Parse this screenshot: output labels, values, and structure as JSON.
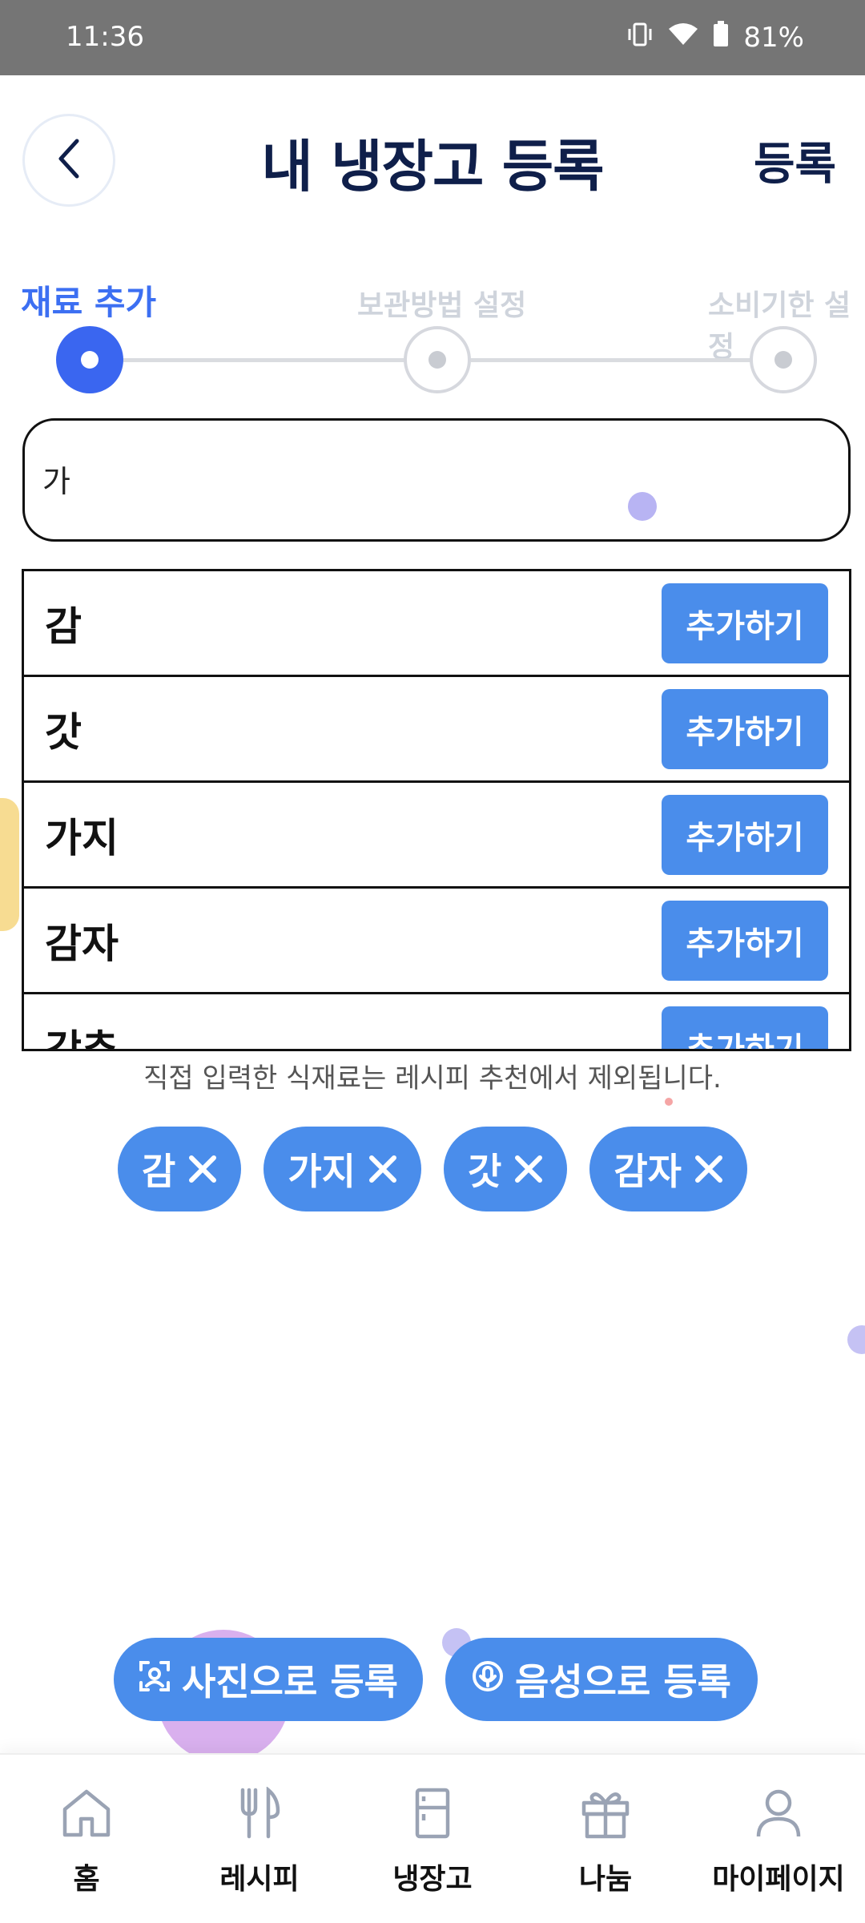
{
  "status_bar": {
    "time": "11:36",
    "battery": "81%"
  },
  "header": {
    "title": "내 냉장고 등록",
    "register_label": "등록"
  },
  "steps": [
    {
      "label": "재료 추가",
      "active": true
    },
    {
      "label": "보관방법 설정",
      "active": false
    },
    {
      "label": "소비기한 설정",
      "active": false
    }
  ],
  "search": {
    "value": "가"
  },
  "results": [
    {
      "name": "감",
      "button": "추가하기"
    },
    {
      "name": "갓",
      "button": "추가하기"
    },
    {
      "name": "가지",
      "button": "추가하기"
    },
    {
      "name": "감자",
      "button": "추가하기"
    },
    {
      "name": "갓추",
      "button": "추가하기"
    }
  ],
  "notice": "직접 입력한 식재료는 레시피 추천에서 제외됩니다.",
  "chips": [
    {
      "label": "감"
    },
    {
      "label": "가지"
    },
    {
      "label": "갓"
    },
    {
      "label": "감자"
    }
  ],
  "actions": {
    "photo": "사진으로 등록",
    "voice": "음성으로 등록"
  },
  "nav": [
    {
      "label": "홈",
      "icon": "home-icon"
    },
    {
      "label": "레시피",
      "icon": "fork-knife-icon"
    },
    {
      "label": "냉장고",
      "icon": "fridge-icon"
    },
    {
      "label": "나눔",
      "icon": "gift-icon"
    },
    {
      "label": "마이페이지",
      "icon": "person-icon"
    }
  ],
  "colors": {
    "primary": "#4a8deb",
    "step_active": "#3a66f0",
    "title": "#0f1f4a"
  }
}
